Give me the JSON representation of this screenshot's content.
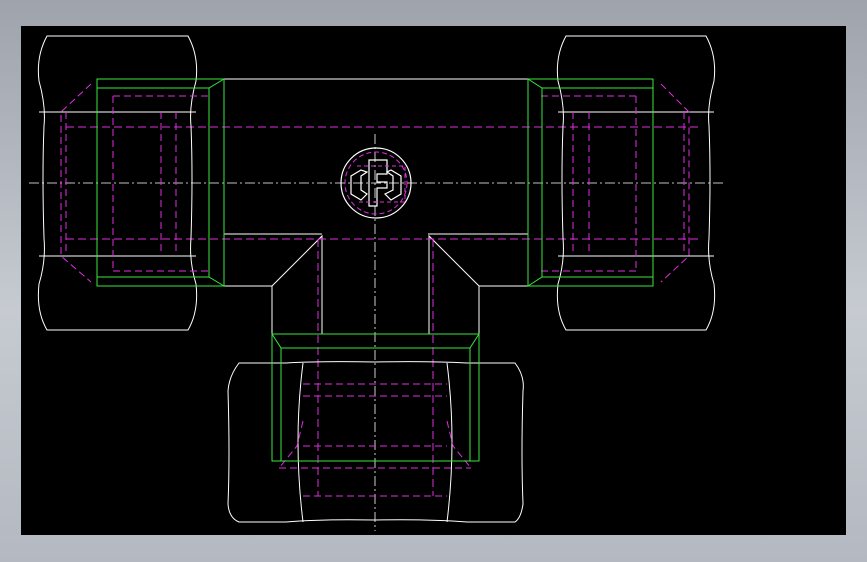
{
  "window": {
    "background_colors": {
      "frame_top": "#9ea3ac",
      "frame_bottom": "#b4b9c1",
      "viewport": "#000000"
    }
  },
  "drawing": {
    "subject": "tee-fitting-with-three-hex-nuts",
    "views": [
      "front-view"
    ],
    "line_colors": {
      "visible_edges": "#ffffff",
      "hidden_edges": "#e02ee0",
      "sleeve_outline": "#3ce63c",
      "centerlines": "#ffffff"
    },
    "components": [
      {
        "name": "left-hex-nut",
        "type": "hex-nut"
      },
      {
        "name": "right-hex-nut",
        "type": "hex-nut"
      },
      {
        "name": "bottom-hex-nut",
        "type": "hex-nut"
      },
      {
        "name": "tee-body",
        "type": "body"
      },
      {
        "name": "left-sleeve",
        "type": "sleeve"
      },
      {
        "name": "right-sleeve",
        "type": "sleeve"
      },
      {
        "name": "bottom-sleeve",
        "type": "sleeve"
      },
      {
        "name": "logo-emblem",
        "type": "manufacturer-logo"
      }
    ]
  }
}
